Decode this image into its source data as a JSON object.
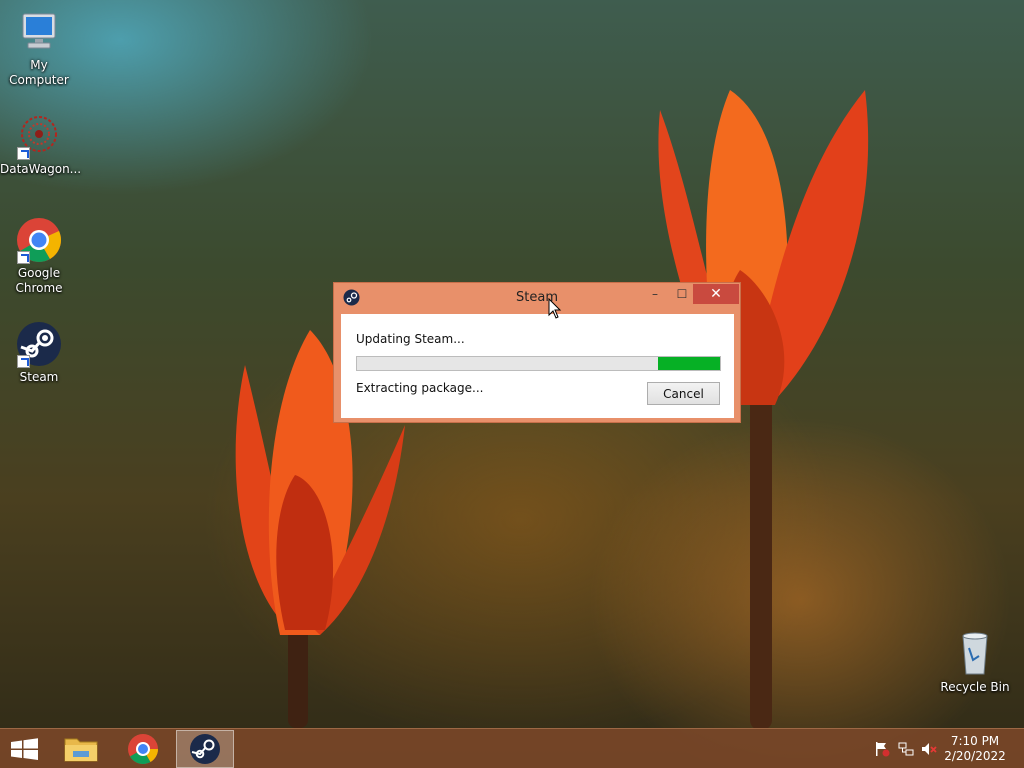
{
  "desktop": {
    "icons": [
      {
        "label": "My Computer"
      },
      {
        "label": "DataWagon..."
      },
      {
        "label": "Google Chrome"
      },
      {
        "label": "Steam"
      },
      {
        "label": "Recycle Bin"
      }
    ]
  },
  "dialog": {
    "title": "Steam",
    "status": "Updating Steam...",
    "sub_status": "Extracting package...",
    "cancel_label": "Cancel",
    "progress_percent": 17,
    "minimize_glyph": "–",
    "maximize_glyph": "☐",
    "close_glyph": "✕"
  },
  "taskbar": {
    "clock_time": "7:10 PM",
    "clock_date": "2/20/2022"
  },
  "colors": {
    "accent_titlebar": "#e8906a",
    "close_button": "#c94a3f",
    "progress_green": "#06b025"
  }
}
